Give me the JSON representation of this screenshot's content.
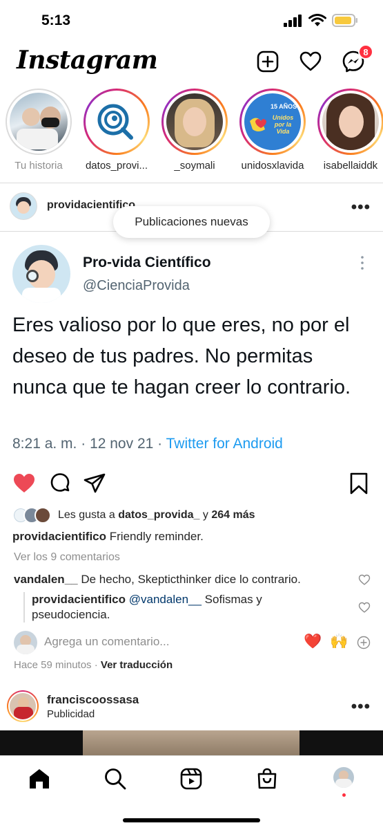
{
  "status_bar": {
    "time": "5:13"
  },
  "header": {
    "logo": "Instagram",
    "messages_badge": "8"
  },
  "stories": [
    {
      "label": "Tu historia",
      "own": true
    },
    {
      "label": "datos_provi..."
    },
    {
      "label": "_soymali"
    },
    {
      "label": "unidosxlavida",
      "badge_text": "15 AÑOS",
      "badge_sub": "Unidos por la Vida"
    },
    {
      "label": "isabellaiddk"
    }
  ],
  "post": {
    "username": "providacientifico",
    "new_posts_label": "Publicaciones nuevas",
    "tweet": {
      "name": "Pro-vida Científico",
      "handle": "@CienciaProvida",
      "text": "Eres valioso por lo que eres, no por el deseo de tus padres. No permitas nunca que te hagan creer lo contrario.",
      "time": "8:21 a. m.",
      "date": "12 nov 21",
      "source": "Twitter for Android"
    },
    "likes": {
      "prefix": "Les gusta a",
      "user": "datos_provida_",
      "conj": "y",
      "count_text": "264 más"
    },
    "caption": {
      "user": "providacientifico",
      "text": "Friendly reminder."
    },
    "view_comments": "Ver los 9 comentarios",
    "comments": [
      {
        "user": "vandalen__",
        "text": "De hecho, Skepticthinker dice lo contrario."
      }
    ],
    "reply": {
      "user": "providacientifico",
      "mention": "@vandalen__",
      "text": "Sofismas y pseudociencia."
    },
    "add_comment_placeholder": "Agrega un comentario...",
    "time_ago": "Hace 59 minutos",
    "translate": "Ver traducción"
  },
  "ad": {
    "username": "franciscoossasa",
    "sponsored": "Publicidad"
  },
  "colors": {
    "like_red": "#ed4956",
    "link_blue": "#1d9bf0",
    "badge_red": "#ff3040"
  },
  "icons": {
    "new_post": "plus-square-icon",
    "activity": "heart-icon",
    "messenger": "messenger-icon",
    "home": "home-icon",
    "search": "search-icon",
    "reels": "reels-icon",
    "shop": "shop-icon"
  }
}
